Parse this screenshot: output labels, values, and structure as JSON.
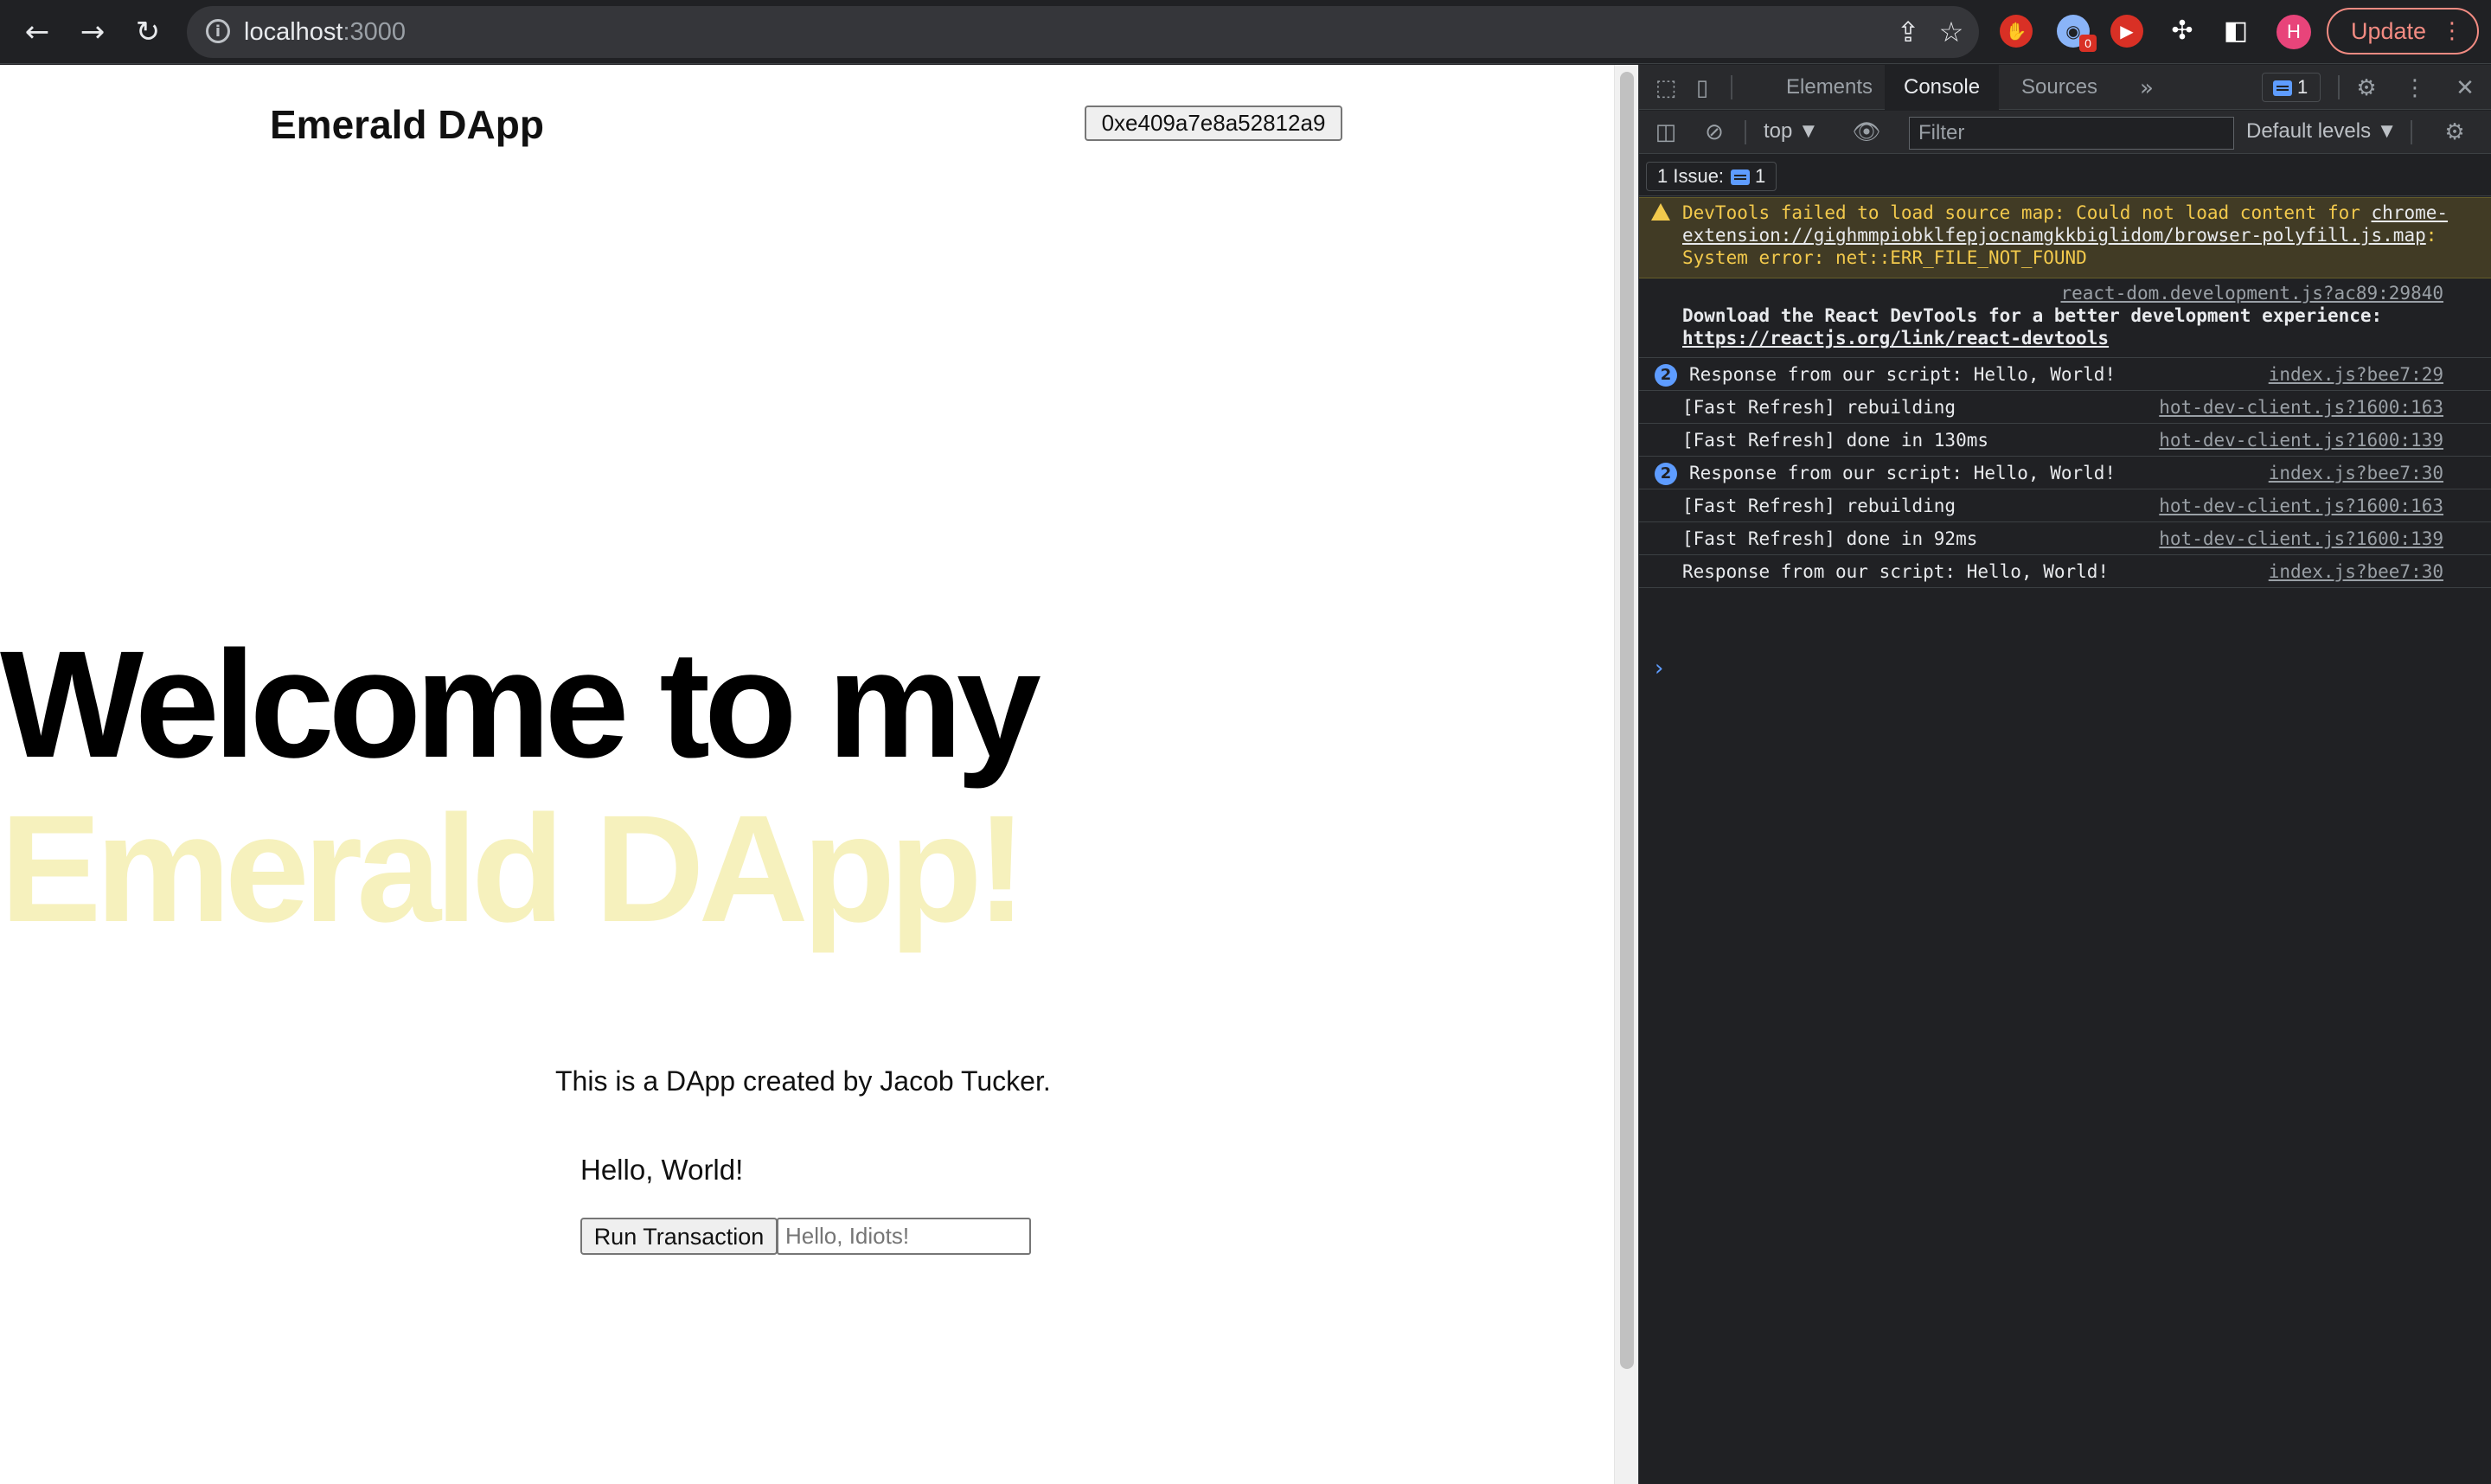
{
  "browser": {
    "url_host": "localhost",
    "url_port": ":3000",
    "avatar_letter": "H",
    "ext_badge": "0",
    "update_label": "Update"
  },
  "page": {
    "site_title": "Emerald DApp",
    "address_button": "0xe409a7e8a52812a9",
    "hero_plain": "Welcome to my ",
    "hero_accent": "Emerald DApp!",
    "byline": "This is a DApp created by Jacob Tucker.",
    "greeting": "Hello, World!",
    "run_button": "Run Transaction",
    "input_placeholder": "Hello, Idiots!",
    "colors": {
      "accent": "#f6f1bd"
    }
  },
  "devtools": {
    "tabs": [
      {
        "label": "Elements"
      },
      {
        "label": "Console"
      },
      {
        "label": "Sources"
      }
    ],
    "issue_badge_count": "1",
    "context": "top ▼",
    "filter_placeholder": "Filter",
    "levels": "Default levels ▼",
    "issues_chip": "1 Issue:",
    "issues_chip_count": "1",
    "warning": {
      "prefix": "DevTools failed to load source map: Could not load content for ",
      "link": "chrome-extension://gighmmpiobklfepjocnamgkkbiglidom/browser-polyfill.js.map",
      "suffix": ": System error: net::ERR_FILE_NOT_FOUND"
    },
    "react_info": {
      "source": "react-dom.development.js?ac89:29840",
      "text": "Download the React DevTools for a better development experience: ",
      "link": "https://reactjs.org/link/react-devtools"
    },
    "logs": [
      {
        "count": "2",
        "message": "Response from our script: Hello, World!",
        "source": "index.js?bee7:29"
      },
      {
        "message": "[Fast Refresh] rebuilding",
        "source": "hot-dev-client.js?1600:163"
      },
      {
        "message": "[Fast Refresh] done in 130ms",
        "source": "hot-dev-client.js?1600:139"
      },
      {
        "count": "2",
        "message": "Response from our script: Hello, World!",
        "source": "index.js?bee7:30"
      },
      {
        "message": "[Fast Refresh] rebuilding",
        "source": "hot-dev-client.js?1600:163"
      },
      {
        "message": "[Fast Refresh] done in 92ms",
        "source": "hot-dev-client.js?1600:139"
      },
      {
        "message": "Response from our script: Hello, World!",
        "source": "index.js?bee7:30"
      }
    ],
    "prompt": "›"
  }
}
